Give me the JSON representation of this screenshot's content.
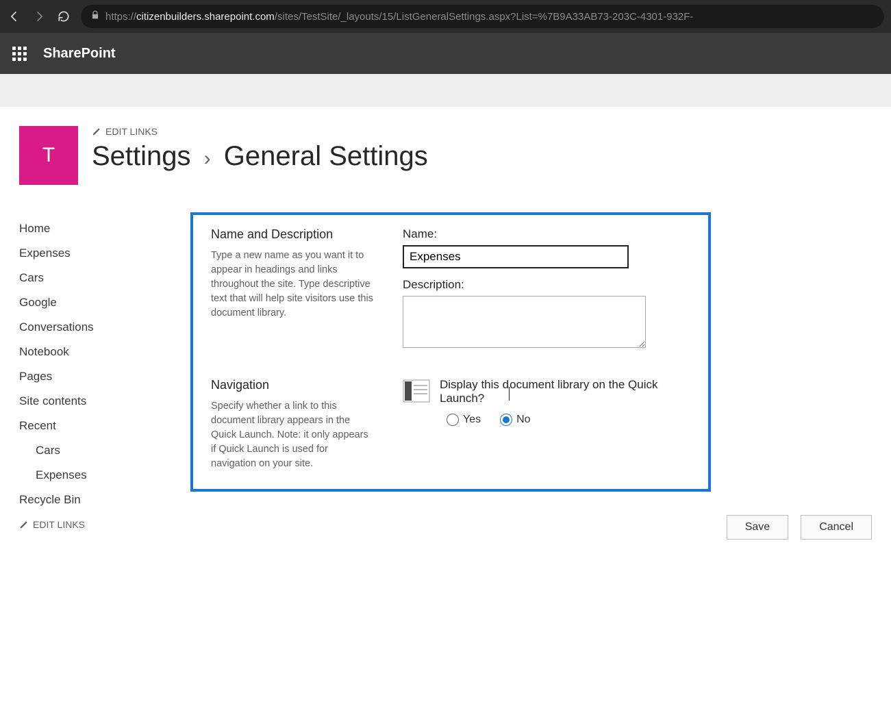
{
  "browser": {
    "url_domain": "citizenbuilders.sharepoint.com",
    "url_prefix": "https://",
    "url_path": "/sites/TestSite/_layouts/15/ListGeneralSettings.aspx?List=%7B9A33AB73-203C-4301-932F-"
  },
  "suite": {
    "title": "SharePoint"
  },
  "site": {
    "logo_letter": "T",
    "edit_links": "EDIT LINKS"
  },
  "breadcrumb": {
    "part1": "Settings",
    "part2": "General Settings"
  },
  "left_nav": {
    "items": [
      "Home",
      "Expenses",
      "Cars",
      "Google",
      "Conversations",
      "Notebook",
      "Pages",
      "Site contents",
      "Recent"
    ],
    "recent_children": [
      "Cars",
      "Expenses"
    ],
    "recycle": "Recycle Bin",
    "edit_links": "EDIT LINKS"
  },
  "form": {
    "section1": {
      "title": "Name and Description",
      "desc": "Type a new name as you want it to appear in headings and links throughout the site. Type descriptive text that will help site visitors use this document library.",
      "name_label": "Name:",
      "name_value": "Expenses",
      "desc_label": "Description:",
      "desc_value": ""
    },
    "section2": {
      "title": "Navigation",
      "desc": "Specify whether a link to this document library appears in the Quick Launch. Note: it only appears if Quick Launch is used for navigation on your site.",
      "question_part1": "Display this ",
      "question_part2": "ocument library on the Quick Launch?",
      "yes": "Yes",
      "no": "No",
      "selected": "No"
    }
  },
  "buttons": {
    "save": "Save",
    "cancel": "Cancel"
  }
}
